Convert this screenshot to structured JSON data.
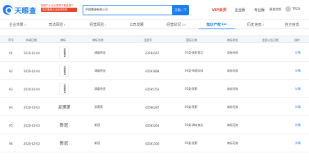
{
  "header": {
    "logo_text": "天眼查",
    "promo_line1": "国家中小企业发展子基金旗下",
    "promo_line2": "官方备案企业征信机构",
    "search_value": "中国慧源有限公司",
    "search_button": "天眼一下",
    "vip_label": "VIP会员",
    "enterprise_label": "企业版",
    "personal_label": "专业版",
    "app_label": "商务合作",
    "user_label": "TYC0"
  },
  "tabs": [
    {
      "label": "企业背景",
      "count": "3"
    },
    {
      "label": "司法风险",
      "count": "6"
    },
    {
      "label": "经营风险",
      "count": "1"
    },
    {
      "label": "公司发展",
      "count": ""
    },
    {
      "label": "经营状况",
      "count": "125"
    },
    {
      "label": "知识产权",
      "count": "149"
    },
    {
      "label": "历史信息",
      "count": "5"
    },
    {
      "label": "自主信息",
      "count": ""
    }
  ],
  "table": {
    "columns": [
      "序号",
      "申请日期",
      "商标",
      "商标名称",
      "注册号",
      "国际分类",
      "商标状态",
      "注册公告日期",
      "操作"
    ],
    "rows": [
      {
        "no": "91",
        "date": "2020-02-04",
        "mark": "清瘟免显",
        "mark_style": "vertical",
        "name": "清瘟免显",
        "reg": "43594167",
        "class": "05类-医药食品",
        "status": "商标无效",
        "op": "详情"
      },
      {
        "no": "92",
        "date": "2020-02-04",
        "mark": "清瘟免显",
        "mark_style": "vertical",
        "name": "清瘟免显",
        "reg": "43593088",
        "class": "30类-啤酒饮料",
        "status": "商标无效",
        "op": "详情"
      },
      {
        "no": "93",
        "date": "2020-02-04",
        "mark": "清瘟免显",
        "mark_style": "vertical",
        "name": "清瘟免显",
        "reg": "43595753",
        "class": "05类-医药",
        "status": "商标无效",
        "op": "详情"
      },
      {
        "no": "94",
        "date": "2020-02-03",
        "mark": "双黄莲",
        "mark_style": "script",
        "name": "双黄莲",
        "reg": "43586287",
        "class": "05类-医药",
        "status": "商标无效",
        "op": "详情"
      },
      {
        "no": "95",
        "date": "2020-02-03",
        "mark": "新冠",
        "mark_style": "plain",
        "name": "新冠",
        "reg": "43583264",
        "class": "30类-调味食品",
        "status": "商标无效",
        "op": "详情"
      },
      {
        "no": "96",
        "date": "2020-02-03",
        "mark": "新冠",
        "mark_style": "plain",
        "name": "新冠",
        "reg": "43581160",
        "class": "05类-医药",
        "status": "商标无效",
        "op": "详情"
      }
    ]
  },
  "colors": {
    "accent": "#1a7ef0",
    "promo": "#e8442a"
  }
}
